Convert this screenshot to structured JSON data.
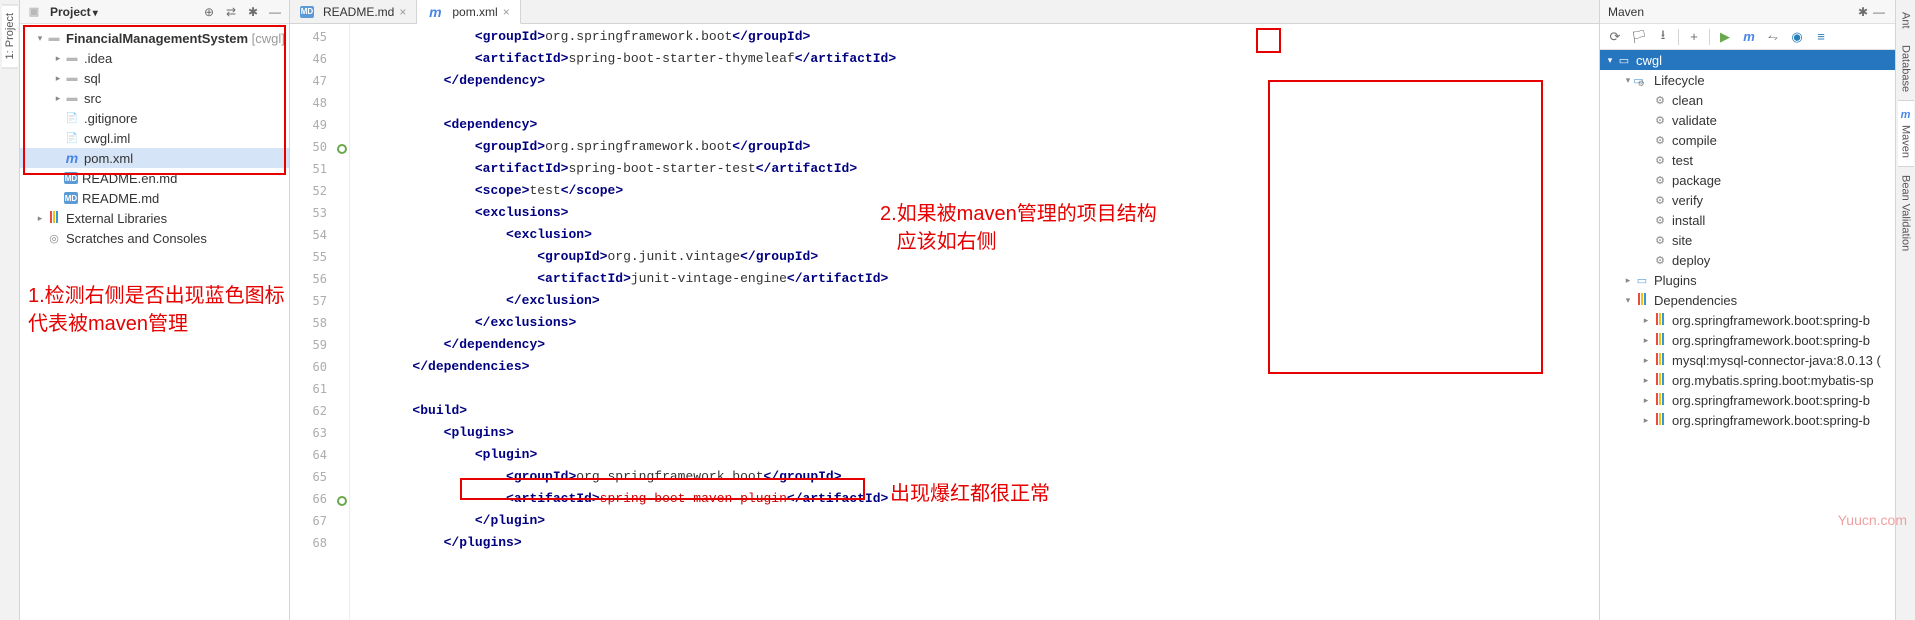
{
  "leftRail": {
    "tab1": "1: Project"
  },
  "projectPanel": {
    "title": "Project",
    "tree": [
      {
        "indent": 0,
        "arrow": "▾",
        "icon": "folder",
        "label": "FinancialManagementSystem",
        "tag": " [cwgl]",
        "bold": true
      },
      {
        "indent": 1,
        "arrow": "▸",
        "icon": "folder",
        "label": ".idea"
      },
      {
        "indent": 1,
        "arrow": "▸",
        "icon": "folder",
        "label": "sql"
      },
      {
        "indent": 1,
        "arrow": "▸",
        "icon": "folder",
        "label": "src"
      },
      {
        "indent": 1,
        "arrow": "",
        "icon": "file",
        "label": ".gitignore"
      },
      {
        "indent": 1,
        "arrow": "",
        "icon": "file",
        "label": "cwgl.iml"
      },
      {
        "indent": 1,
        "arrow": "",
        "icon": "m",
        "label": "pom.xml",
        "selected": true
      },
      {
        "indent": 1,
        "arrow": "",
        "icon": "md",
        "label": "README.en.md"
      },
      {
        "indent": 1,
        "arrow": "",
        "icon": "md",
        "label": "README.md"
      },
      {
        "indent": 0,
        "arrow": "▸",
        "icon": "lib",
        "label": "External Libraries"
      },
      {
        "indent": 0,
        "arrow": "",
        "icon": "scratch",
        "label": "Scratches and Consoles"
      }
    ]
  },
  "editor": {
    "tabs": [
      {
        "icon": "md",
        "label": "README.md",
        "active": false
      },
      {
        "icon": "m",
        "label": "pom.xml",
        "active": true
      }
    ],
    "startLine": 45,
    "lines": [
      {
        "n": 45,
        "indent": 4,
        "tokens": [
          [
            "<",
            "t"
          ],
          [
            "groupId",
            "k"
          ],
          [
            ">",
            "t"
          ],
          [
            "org.springframework.boot",
            "x"
          ],
          [
            "</",
            "t"
          ],
          [
            "groupId",
            "k"
          ],
          [
            ">",
            "t"
          ]
        ]
      },
      {
        "n": 46,
        "indent": 4,
        "tokens": [
          [
            "<",
            "t"
          ],
          [
            "artifactId",
            "k"
          ],
          [
            ">",
            "t"
          ],
          [
            "spring-boot-starter-thymeleaf",
            "x"
          ],
          [
            "</",
            "t"
          ],
          [
            "artifactId",
            "k"
          ],
          [
            ">",
            "t"
          ]
        ]
      },
      {
        "n": 47,
        "indent": 3,
        "tokens": [
          [
            "</",
            "t"
          ],
          [
            "dependency",
            "k"
          ],
          [
            ">",
            "t"
          ]
        ]
      },
      {
        "n": 48,
        "indent": 0,
        "tokens": []
      },
      {
        "n": 49,
        "indent": 3,
        "tokens": [
          [
            "<",
            "t"
          ],
          [
            "dependency",
            "k"
          ],
          [
            ">",
            "t"
          ]
        ]
      },
      {
        "n": 50,
        "mark": "green",
        "indent": 4,
        "tokens": [
          [
            "<",
            "t"
          ],
          [
            "groupId",
            "k"
          ],
          [
            ">",
            "t"
          ],
          [
            "org.springframework.boot",
            "x"
          ],
          [
            "</",
            "t"
          ],
          [
            "groupId",
            "k"
          ],
          [
            ">",
            "t"
          ]
        ]
      },
      {
        "n": 51,
        "indent": 4,
        "tokens": [
          [
            "<",
            "t"
          ],
          [
            "artifactId",
            "k"
          ],
          [
            ">",
            "t"
          ],
          [
            "spring-boot-starter-test",
            "x"
          ],
          [
            "</",
            "t"
          ],
          [
            "artifactId",
            "k"
          ],
          [
            ">",
            "t"
          ]
        ]
      },
      {
        "n": 52,
        "indent": 4,
        "tokens": [
          [
            "<",
            "t"
          ],
          [
            "scope",
            "k"
          ],
          [
            ">",
            "t"
          ],
          [
            "test",
            "x"
          ],
          [
            "</",
            "t"
          ],
          [
            "scope",
            "k"
          ],
          [
            ">",
            "t"
          ]
        ]
      },
      {
        "n": 53,
        "indent": 4,
        "tokens": [
          [
            "<",
            "t"
          ],
          [
            "exclusions",
            "k"
          ],
          [
            ">",
            "t"
          ]
        ]
      },
      {
        "n": 54,
        "indent": 5,
        "tokens": [
          [
            "<",
            "t"
          ],
          [
            "exclusion",
            "k"
          ],
          [
            ">",
            "t"
          ]
        ]
      },
      {
        "n": 55,
        "indent": 6,
        "tokens": [
          [
            "<",
            "t"
          ],
          [
            "groupId",
            "k"
          ],
          [
            ">",
            "t"
          ],
          [
            "org.junit.vintage",
            "x"
          ],
          [
            "</",
            "t"
          ],
          [
            "groupId",
            "k"
          ],
          [
            ">",
            "t"
          ]
        ]
      },
      {
        "n": 56,
        "indent": 6,
        "tokens": [
          [
            "<",
            "t"
          ],
          [
            "artifactId",
            "k"
          ],
          [
            ">",
            "t"
          ],
          [
            "junit-vintage-engine",
            "x"
          ],
          [
            "</",
            "t"
          ],
          [
            "artifactId",
            "k"
          ],
          [
            ">",
            "t"
          ]
        ]
      },
      {
        "n": 57,
        "indent": 5,
        "tokens": [
          [
            "</",
            "t"
          ],
          [
            "exclusion",
            "k"
          ],
          [
            ">",
            "t"
          ]
        ]
      },
      {
        "n": 58,
        "indent": 4,
        "tokens": [
          [
            "</",
            "t"
          ],
          [
            "exclusions",
            "k"
          ],
          [
            ">",
            "t"
          ]
        ]
      },
      {
        "n": 59,
        "indent": 3,
        "tokens": [
          [
            "</",
            "t"
          ],
          [
            "dependency",
            "k"
          ],
          [
            ">",
            "t"
          ]
        ]
      },
      {
        "n": 60,
        "indent": 2,
        "tokens": [
          [
            "</",
            "t"
          ],
          [
            "dependencies",
            "k"
          ],
          [
            ">",
            "t"
          ]
        ]
      },
      {
        "n": 61,
        "indent": 0,
        "tokens": []
      },
      {
        "n": 62,
        "indent": 2,
        "tokens": [
          [
            "<",
            "t"
          ],
          [
            "build",
            "k"
          ],
          [
            ">",
            "t"
          ]
        ]
      },
      {
        "n": 63,
        "indent": 3,
        "tokens": [
          [
            "<",
            "t"
          ],
          [
            "plugins",
            "k"
          ],
          [
            ">",
            "t"
          ]
        ]
      },
      {
        "n": 64,
        "indent": 4,
        "tokens": [
          [
            "<",
            "t"
          ],
          [
            "plugin",
            "k"
          ],
          [
            ">",
            "t"
          ]
        ]
      },
      {
        "n": 65,
        "indent": 5,
        "tokens": [
          [
            "<",
            "t"
          ],
          [
            "groupId",
            "k"
          ],
          [
            ">",
            "t"
          ],
          [
            "org.springframework.boot",
            "x"
          ],
          [
            "</",
            "t"
          ],
          [
            "groupId",
            "k"
          ],
          [
            ">",
            "t"
          ]
        ]
      },
      {
        "n": 66,
        "mark": "green",
        "indent": 5,
        "tokens": [
          [
            "<",
            "t"
          ],
          [
            "artifactId",
            "k"
          ],
          [
            ">",
            "t"
          ],
          [
            "spring-boot-maven-plugin",
            "e"
          ],
          [
            "</",
            "t"
          ],
          [
            "artifactId",
            "k"
          ],
          [
            ">",
            "t"
          ]
        ]
      },
      {
        "n": 67,
        "indent": 4,
        "tokens": [
          [
            "</",
            "t"
          ],
          [
            "plugin",
            "k"
          ],
          [
            ">",
            "t"
          ]
        ]
      },
      {
        "n": 68,
        "indent": 3,
        "tokens": [
          [
            "</",
            "t"
          ],
          [
            "plugins",
            "k"
          ],
          [
            ">",
            "t"
          ]
        ]
      }
    ]
  },
  "maven": {
    "title": "Maven",
    "root": "cwgl",
    "lifecycle": {
      "label": "Lifecycle",
      "items": [
        "clean",
        "validate",
        "compile",
        "test",
        "package",
        "verify",
        "install",
        "site",
        "deploy"
      ]
    },
    "plugins": "Plugins",
    "dependencies": {
      "label": "Dependencies",
      "items": [
        "org.springframework.boot:spring-b",
        "org.springframework.boot:spring-b",
        "mysql:mysql-connector-java:8.0.13 (",
        "org.mybatis.spring.boot:mybatis-sp",
        "org.springframework.boot:spring-b",
        "org.springframework.boot:spring-b"
      ]
    }
  },
  "rightRail": {
    "tabs": [
      "Ant",
      "Database",
      "Maven",
      "Bean Validation"
    ]
  },
  "annotations": {
    "a1": "1.检测右侧是否出现蓝色图标\n代表被maven管理",
    "a2": "2.如果被maven管理的项目结构\n   应该如右侧",
    "a3": "出现爆红都很正常"
  },
  "watermark": "Yuucn.com"
}
